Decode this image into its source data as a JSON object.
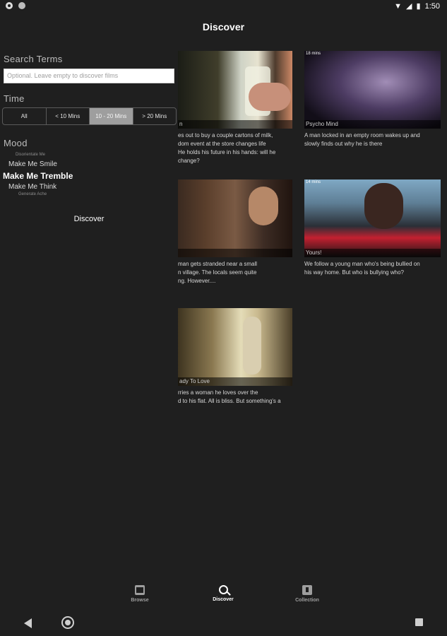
{
  "status_bar": {
    "time": "1:50"
  },
  "app_bar": {
    "title": "Discover"
  },
  "panel": {
    "search_label": "Search Terms",
    "search_placeholder": "Optional. Leave empty to discover films",
    "time_label": "Time",
    "time_options": [
      "All",
      "< 10 Mins",
      "10 - 20 Mins",
      "> 20 Mins"
    ],
    "time_selected_index": 2,
    "mood_label": "Mood",
    "moods": {
      "above": "Disorientate Me",
      "item1": "Make Me Smile",
      "selected": "Make Me Tremble",
      "item3": "Make Me Think",
      "below": "Generate Ache"
    },
    "discover_button": "Discover"
  },
  "films": [
    {
      "duration": "",
      "title": "n",
      "desc": "es out to buy a couple cartons of milk,\ndom event at the store changes life\nHe holds his future in his hands: will he\nchange?"
    },
    {
      "duration": "18 mins",
      "title": "Psycho Mind",
      "desc": "A man locked in an empty room wakes up and\nslowly finds out why he is there"
    },
    {
      "duration": "",
      "title": "",
      "desc": "man gets stranded near a small\nn village. The locals seem quite\nng. However...."
    },
    {
      "duration": "14 mins",
      "title": "Yours!",
      "desc": "We follow a young man who's being bullied on\nhis way home. But who is bullying who?"
    },
    {
      "duration": "",
      "title": "ady To Love",
      "desc": "rries a woman he loves over the\nd to his flat. All is bliss. But something's a"
    }
  ],
  "bottom_nav": {
    "browse": "Browse",
    "discover": "Discover",
    "collection": "Collection"
  }
}
